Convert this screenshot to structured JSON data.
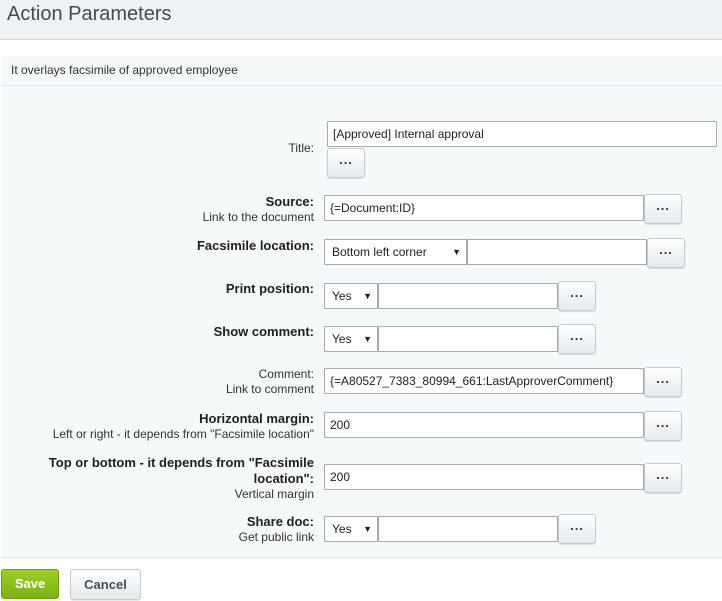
{
  "header": {
    "title": "Action Parameters"
  },
  "description": "It overlays facsimile of approved employee",
  "fields": {
    "title": {
      "label": "Title:",
      "value": "[Approved] Internal approval"
    },
    "source": {
      "label": "Source:",
      "sublabel": "Link to the document",
      "value": "{=Document:ID}"
    },
    "facsimile_location": {
      "label": "Facsimile location:",
      "selected": "Bottom left corner",
      "value": ""
    },
    "print_position": {
      "label": "Print position:",
      "selected": "Yes",
      "value": ""
    },
    "show_comment": {
      "label": "Show comment:",
      "selected": "Yes",
      "value": ""
    },
    "comment": {
      "label": "Comment:",
      "sublabel": "Link to comment",
      "value": "{=A80527_7383_80994_661:LastApproverComment}"
    },
    "horizontal_margin": {
      "label": "Horizontal margin:",
      "sublabel": "Left or right - it depends from \"Facsimile location\"",
      "value": "200"
    },
    "vertical_margin": {
      "label": "Top or bottom - it depends from \"Facsimile location\":",
      "sublabel": "Vertical margin",
      "value": "200"
    },
    "share_doc": {
      "label": "Share doc:",
      "sublabel": "Get public link",
      "selected": "Yes",
      "value": ""
    }
  },
  "picker_button": "...",
  "select_arrow": "▼",
  "buttons": {
    "save": "Save",
    "cancel": "Cancel"
  }
}
